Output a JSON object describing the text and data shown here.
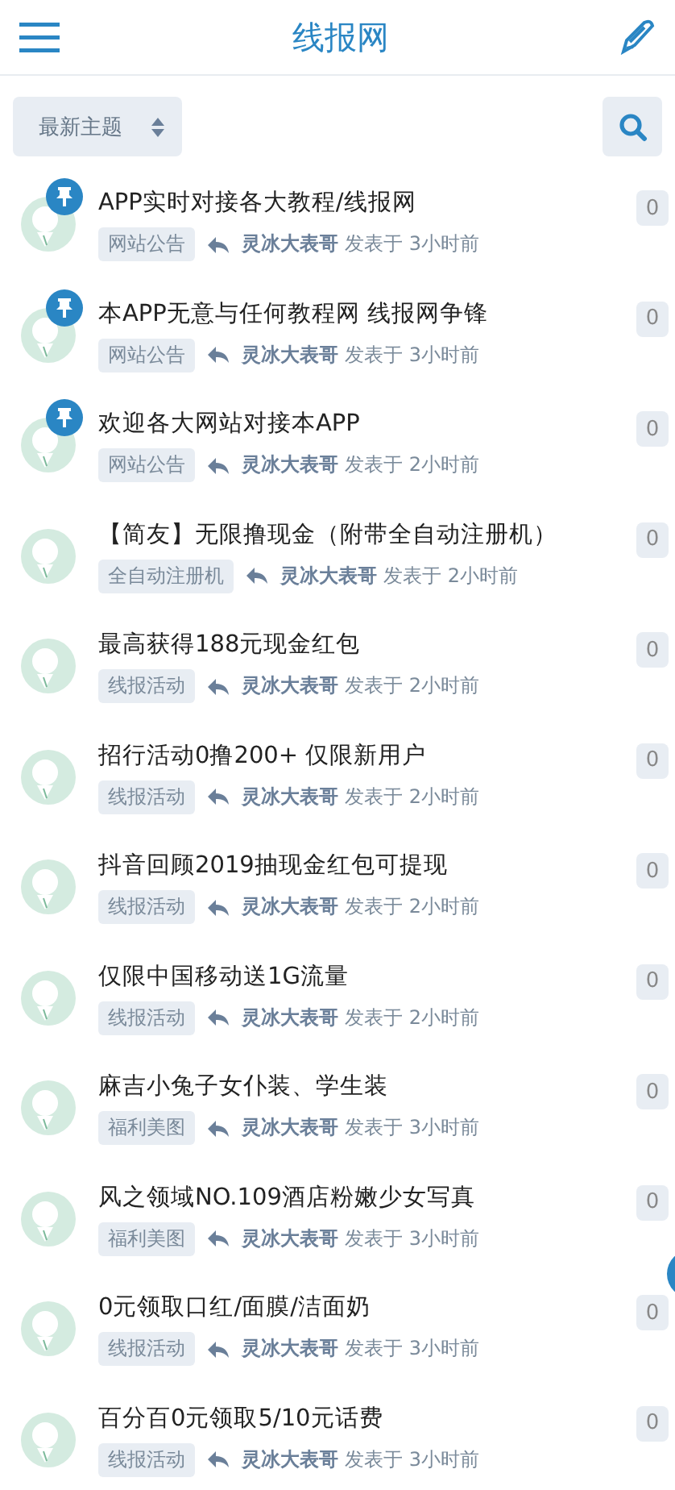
{
  "header": {
    "title": "线报网"
  },
  "filter": {
    "label": "最新主题"
  },
  "topics": [
    {
      "title": "APP实时对接各大教程/线报网",
      "tag": "网站公告",
      "author": "灵冰大表哥",
      "posted": "发表于 3小时前",
      "replies": "0",
      "pinned": true
    },
    {
      "title": "本APP无意与任何教程网 线报网争锋",
      "tag": "网站公告",
      "author": "灵冰大表哥",
      "posted": "发表于 3小时前",
      "replies": "0",
      "pinned": true
    },
    {
      "title": "欢迎各大网站对接本APP",
      "tag": "网站公告",
      "author": "灵冰大表哥",
      "posted": "发表于 2小时前",
      "replies": "0",
      "pinned": true
    },
    {
      "title": "【简友】无限撸现金（附带全自动注册机）",
      "tag": "全自动注册机",
      "author": "灵冰大表哥",
      "posted": "发表于 2小时前",
      "replies": "0",
      "pinned": false
    },
    {
      "title": "最高获得188元现金红包",
      "tag": "线报活动",
      "author": "灵冰大表哥",
      "posted": "发表于 2小时前",
      "replies": "0",
      "pinned": false
    },
    {
      "title": "招行活动0撸200+ 仅限新用户",
      "tag": "线报活动",
      "author": "灵冰大表哥",
      "posted": "发表于 2小时前",
      "replies": "0",
      "pinned": false
    },
    {
      "title": "抖音回顾2019抽现金红包可提现",
      "tag": "线报活动",
      "author": "灵冰大表哥",
      "posted": "发表于 2小时前",
      "replies": "0",
      "pinned": false
    },
    {
      "title": "仅限中国移动送1G流量",
      "tag": "线报活动",
      "author": "灵冰大表哥",
      "posted": "发表于 2小时前",
      "replies": "0",
      "pinned": false
    },
    {
      "title": "麻吉小兔子女仆装、学生装",
      "tag": "福利美图",
      "author": "灵冰大表哥",
      "posted": "发表于 3小时前",
      "replies": "0",
      "pinned": false
    },
    {
      "title": "风之领域NO.109酒店粉嫩少女写真",
      "tag": "福利美图",
      "author": "灵冰大表哥",
      "posted": "发表于 3小时前",
      "replies": "0",
      "pinned": false
    },
    {
      "title": "0元领取口红/面膜/洁面奶",
      "tag": "线报活动",
      "author": "灵冰大表哥",
      "posted": "发表于 3小时前",
      "replies": "0",
      "pinned": false
    },
    {
      "title": "百分百0元领取5/10元话费",
      "tag": "线报活动",
      "author": "灵冰大表哥",
      "posted": "发表于 3小时前",
      "replies": "0",
      "pinned": false
    }
  ]
}
